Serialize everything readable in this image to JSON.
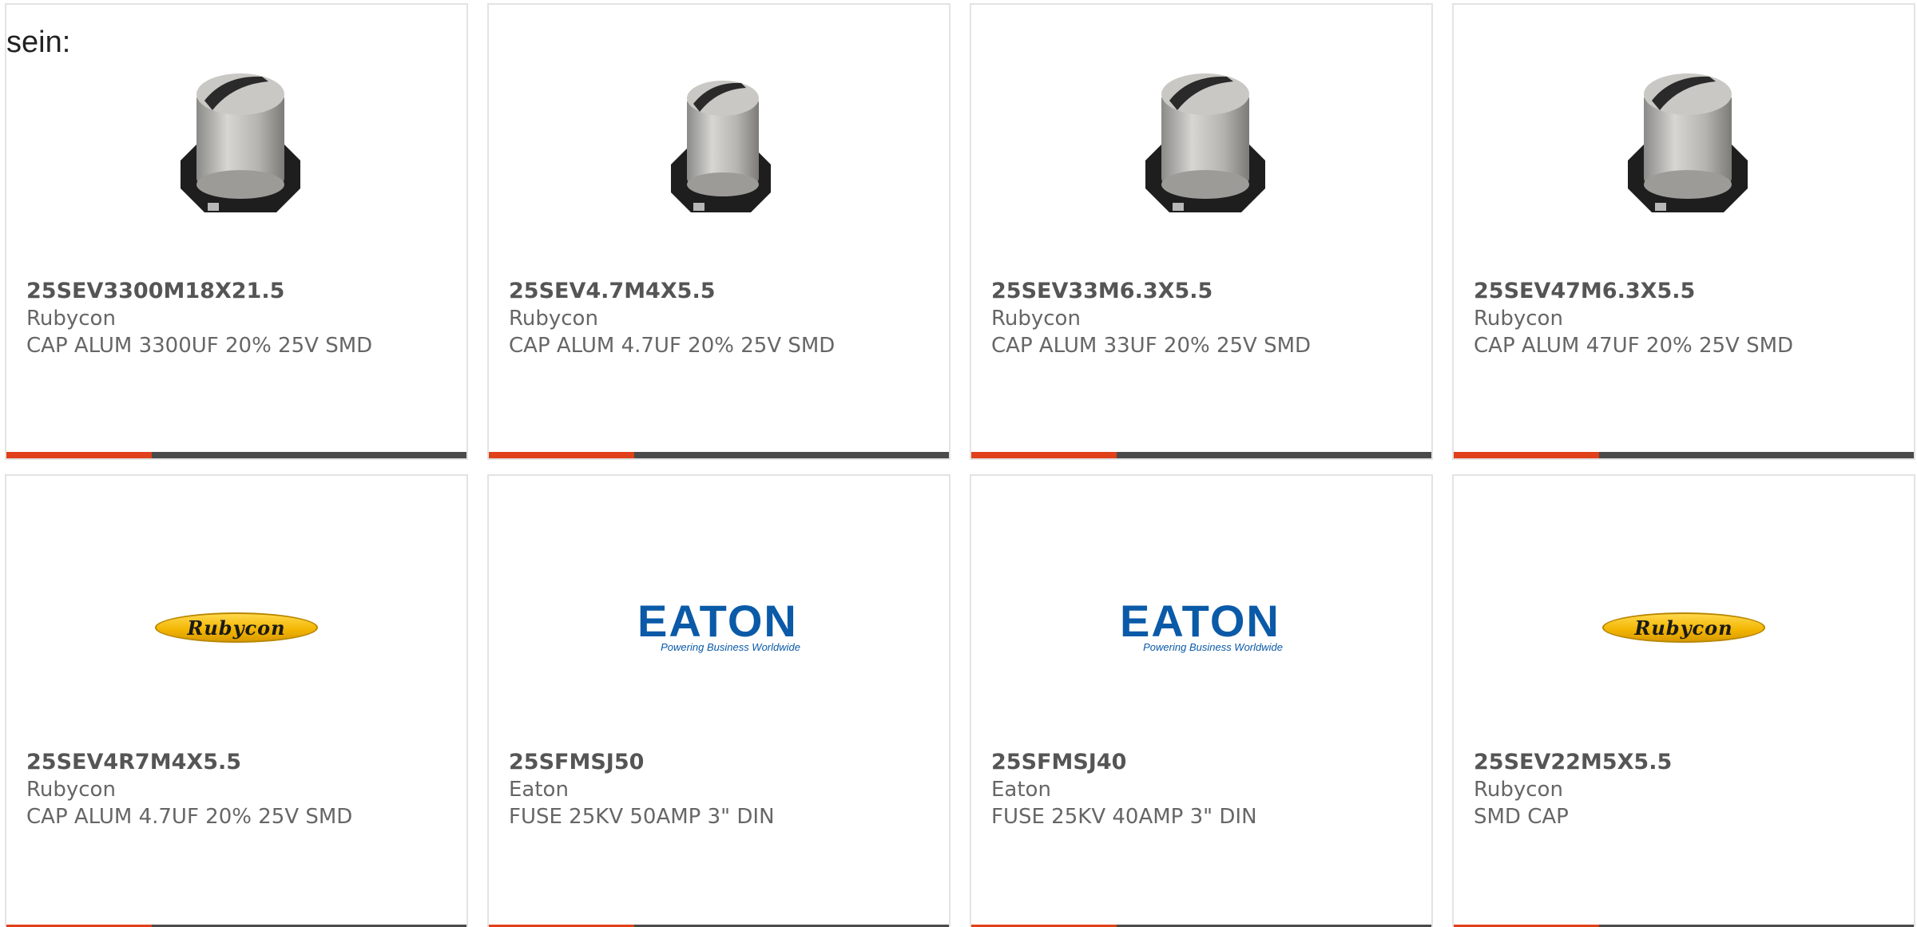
{
  "intro": {
    "text": "sein:"
  },
  "colors": {
    "accent": "#e0401a",
    "bar": "#4a4a4a",
    "border": "#e3e3e3"
  },
  "products": [
    {
      "part": "25SEV3300M18X21.5",
      "maker": "Rubycon",
      "desc": "CAP ALUM 3300UF 20% 25V SMD",
      "image": "capacitor-photo"
    },
    {
      "part": "25SEV4.7M4X5.5",
      "maker": "Rubycon",
      "desc": "CAP ALUM 4.7UF 20% 25V SMD",
      "image": "capacitor-photo"
    },
    {
      "part": "25SEV33M6.3X5.5",
      "maker": "Rubycon",
      "desc": "CAP ALUM 33UF 20% 25V SMD",
      "image": "capacitor-photo"
    },
    {
      "part": "25SEV47M6.3X5.5",
      "maker": "Rubycon",
      "desc": "CAP ALUM 47UF 20% 25V SMD",
      "image": "capacitor-photo"
    },
    {
      "part": "25SEV4R7M4X5.5",
      "maker": "Rubycon",
      "desc": "CAP ALUM 4.7UF 20% 25V SMD",
      "image": "rubycon-logo",
      "logo_text": "Rubycon"
    },
    {
      "part": "25SFMSJ50",
      "maker": "Eaton",
      "desc": "FUSE 25KV 50AMP 3\" DIN",
      "image": "eaton-logo",
      "logo_text": "EATON",
      "logo_tagline": "Powering Business Worldwide"
    },
    {
      "part": "25SFMSJ40",
      "maker": "Eaton",
      "desc": "FUSE 25KV 40AMP 3\" DIN",
      "image": "eaton-logo",
      "logo_text": "EATON",
      "logo_tagline": "Powering Business Worldwide"
    },
    {
      "part": "25SEV22M5X5.5",
      "maker": "Rubycon",
      "desc": "SMD CAP",
      "image": "rubycon-logo",
      "logo_text": "Rubycon"
    }
  ]
}
